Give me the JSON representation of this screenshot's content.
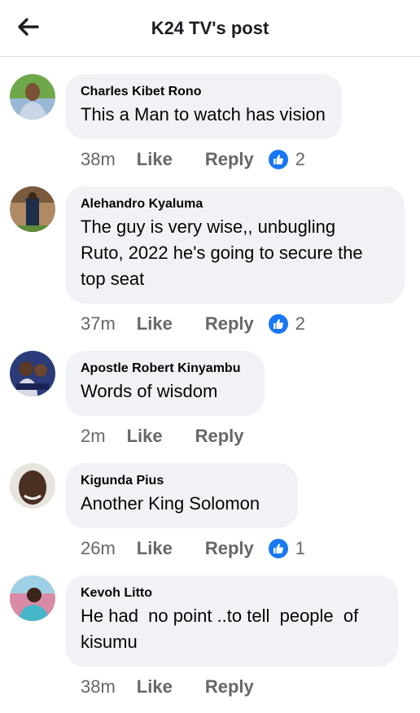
{
  "header": {
    "title": "K24 TV's post",
    "back_icon": "arrow-left-icon"
  },
  "colors": {
    "bubble": "#f0f2f5",
    "meta": "#65676b",
    "like_blue": "#1877f2"
  },
  "comments": [
    {
      "author": "Charles Kibet Rono",
      "text": "This a Man to watch has vision",
      "time": "38m",
      "like": "Like",
      "reply": "Reply",
      "reactions": "2"
    },
    {
      "author": "Alehandro Kyaluma",
      "text": "The guy is very wise,, unbugling\nRuto, 2022 he's going to secure the\ntop seat",
      "time": "37m",
      "like": "Like",
      "reply": "Reply",
      "reactions": "2"
    },
    {
      "author": "Apostle Robert Kinyambu",
      "text": "Words of wisdom",
      "time": "2m",
      "like": "Like",
      "reply": "Reply",
      "reactions": null
    },
    {
      "author": "Kigunda Pius",
      "text": "Another King Solomon",
      "time": "26m",
      "like": "Like",
      "reply": "Reply",
      "reactions": "1"
    },
    {
      "author": "Kevoh Litto",
      "text": "He had  no point ..to tell  people  of\nkisumu",
      "time": "38m",
      "like": "Like",
      "reply": "Reply",
      "reactions": null
    }
  ]
}
